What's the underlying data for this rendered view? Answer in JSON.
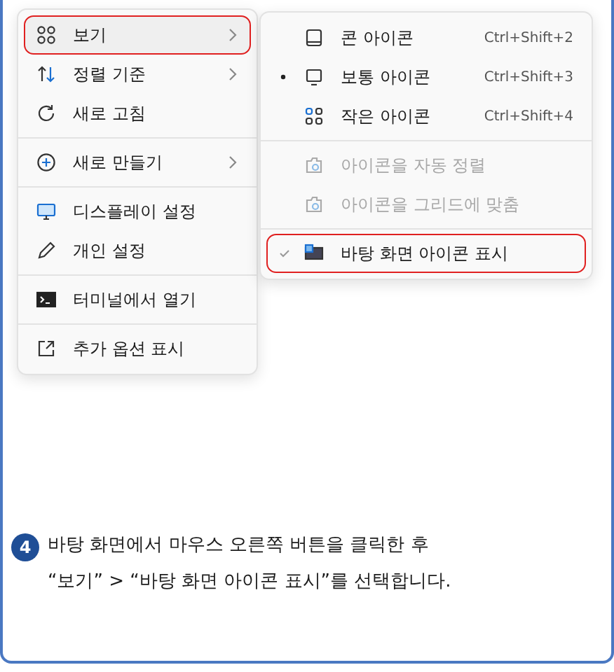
{
  "context_menu": {
    "items": [
      {
        "kind": "item",
        "label": "보기",
        "submenu": true,
        "highlighted": true
      },
      {
        "kind": "item",
        "label": "정렬 기준",
        "submenu": true,
        "highlighted": false
      },
      {
        "kind": "item",
        "label": "새로 고침",
        "submenu": false,
        "highlighted": false
      },
      {
        "kind": "separator"
      },
      {
        "kind": "item",
        "label": "새로 만들기",
        "submenu": true,
        "highlighted": false
      },
      {
        "kind": "separator"
      },
      {
        "kind": "item",
        "label": "디스플레이 설정",
        "submenu": false,
        "highlighted": false
      },
      {
        "kind": "item",
        "label": "개인 설정",
        "submenu": false,
        "highlighted": false
      },
      {
        "kind": "separator"
      },
      {
        "kind": "item",
        "label": "터미널에서 열기",
        "submenu": false,
        "highlighted": false
      },
      {
        "kind": "separator"
      },
      {
        "kind": "item",
        "label": "추가 옵션 표시",
        "submenu": false,
        "highlighted": false
      }
    ]
  },
  "view_submenu": {
    "items": [
      {
        "kind": "radio",
        "label": "콘 아이콘",
        "shortcut": "Ctrl+Shift+2",
        "selected": false,
        "disabled": false,
        "highlighted": false
      },
      {
        "kind": "radio",
        "label": "보통 아이콘",
        "shortcut": "Ctrl+Shift+3",
        "selected": true,
        "disabled": false,
        "highlighted": false
      },
      {
        "kind": "radio",
        "label": "작은 아이콘",
        "shortcut": "Ctrl+Shift+4",
        "selected": false,
        "disabled": false,
        "highlighted": false
      },
      {
        "kind": "separator"
      },
      {
        "kind": "check",
        "label": "아이콘을 자동 정렬",
        "checked": false,
        "disabled": true,
        "highlighted": false
      },
      {
        "kind": "check",
        "label": "아이콘을 그리드에 맞춤",
        "checked": false,
        "disabled": true,
        "highlighted": false
      },
      {
        "kind": "separator"
      },
      {
        "kind": "check",
        "label": "바탕 화면 아이콘 표시",
        "checked": true,
        "disabled": false,
        "highlighted": true
      }
    ]
  },
  "instruction": {
    "step": "4",
    "lines": [
      "바탕 화면에서 마우스 오른쪽 버튼을 클릭한 후",
      "“보기” > “바탕 화면 아이콘 표시”를 선택합니다."
    ]
  }
}
